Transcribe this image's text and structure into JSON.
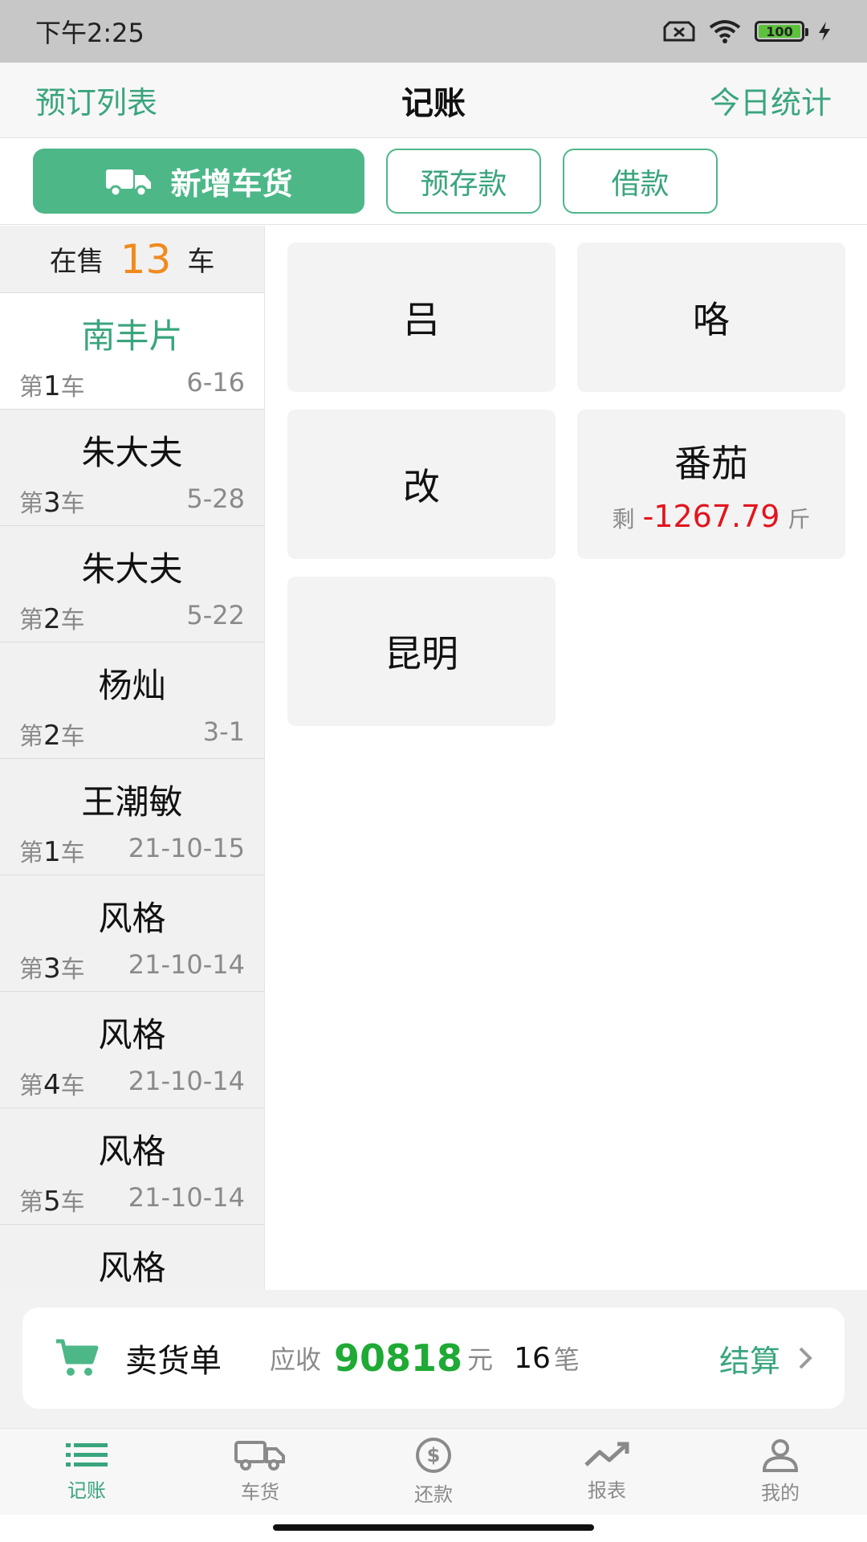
{
  "status": {
    "time": "下午2:25",
    "battery": "100"
  },
  "header": {
    "left_link": "预订列表",
    "title": "记账",
    "right_link": "今日统计"
  },
  "actions": {
    "add_truck": "新增车货",
    "deposit": "预存款",
    "loan": "借款"
  },
  "sidebar": {
    "on_sale_label": "在售",
    "on_sale_count": "13",
    "on_sale_unit": "车",
    "items": [
      {
        "name": "南丰片",
        "prefix": "第",
        "num": "1",
        "suffix": "车",
        "date": "6-16"
      },
      {
        "name": "朱大夫",
        "prefix": "第",
        "num": "3",
        "suffix": "车",
        "date": "5-28"
      },
      {
        "name": "朱大夫",
        "prefix": "第",
        "num": "2",
        "suffix": "车",
        "date": "5-22"
      },
      {
        "name": "杨灿",
        "prefix": "第",
        "num": "2",
        "suffix": "车",
        "date": "3-1"
      },
      {
        "name": "王潮敏",
        "prefix": "第",
        "num": "1",
        "suffix": "车",
        "date": "21-10-15"
      },
      {
        "name": "风格",
        "prefix": "第",
        "num": "3",
        "suffix": "车",
        "date": "21-10-14"
      },
      {
        "name": "风格",
        "prefix": "第",
        "num": "4",
        "suffix": "车",
        "date": "21-10-14"
      },
      {
        "name": "风格",
        "prefix": "第",
        "num": "5",
        "suffix": "车",
        "date": "21-10-14"
      },
      {
        "name": "风格",
        "prefix": "",
        "num": "",
        "suffix": "",
        "date": ""
      }
    ]
  },
  "grid": {
    "tiles": [
      {
        "name": "吕"
      },
      {
        "name": "咯"
      },
      {
        "name": "改"
      },
      {
        "name": "番茄",
        "remain_label": "剩",
        "remain_value": "-1267.79",
        "remain_unit": "斤"
      },
      {
        "name": "昆明"
      }
    ]
  },
  "summary": {
    "title": "卖货单",
    "receivable_label": "应收",
    "amount": "90818",
    "amount_unit": "元",
    "count": "16",
    "count_unit": "笔",
    "settle": "结算"
  },
  "tabs": [
    {
      "label": "记账",
      "icon": "list-icon"
    },
    {
      "label": "车货",
      "icon": "truck-icon"
    },
    {
      "label": "还款",
      "icon": "dollar-icon"
    },
    {
      "label": "报表",
      "icon": "trend-icon"
    },
    {
      "label": "我的",
      "icon": "user-icon"
    }
  ],
  "colors": {
    "accent": "#4db788",
    "accent_text": "#3aa57d",
    "on_sale": "#f08a1d",
    "negative": "#e3141e",
    "amount": "#1eaa34"
  }
}
